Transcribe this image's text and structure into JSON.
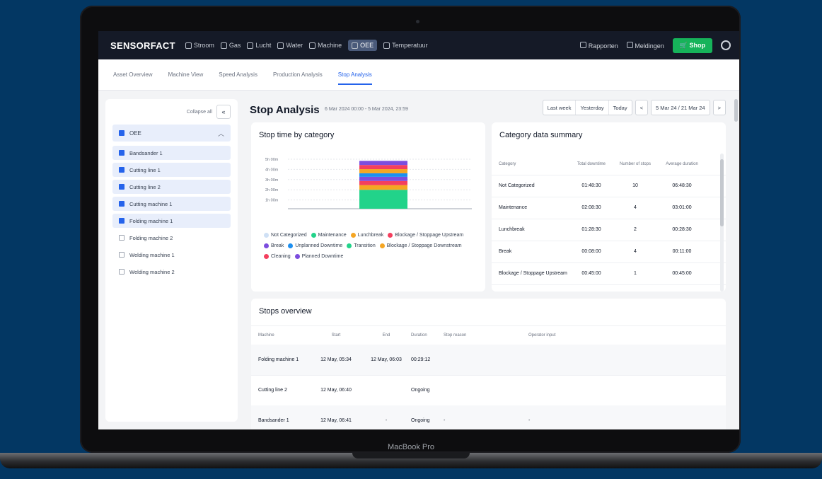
{
  "device": {
    "label": "MacBook Pro"
  },
  "topbar": {
    "brand": "SENSORFACT",
    "nav": [
      "Stroom",
      "Gas",
      "Lucht",
      "Water",
      "Machine",
      "OEE",
      "Temperatuur"
    ],
    "active_nav": "OEE",
    "right": {
      "rapport": "Rapporten",
      "notifications": "Meldingen",
      "shop": "Shop"
    }
  },
  "subtabs": {
    "items": [
      "Asset Overview",
      "Machine View",
      "Speed Analysis",
      "Production Analysis",
      "Stop Analysis"
    ],
    "active": "Stop Analysis"
  },
  "sidebar": {
    "collapse_label": "Collapse all",
    "collapse_icon": "«",
    "group": "OEE",
    "machines": [
      {
        "label": "Bandsander 1",
        "checked": true
      },
      {
        "label": "Cutting line 1",
        "checked": true
      },
      {
        "label": "Cutting line 2",
        "checked": true
      },
      {
        "label": "Cutting machine 1",
        "checked": true
      },
      {
        "label": "Folding machine 1",
        "checked": true
      },
      {
        "label": "Folding machine 2",
        "checked": false
      },
      {
        "label": "Welding machine 1",
        "checked": false
      },
      {
        "label": "Welding machine 2",
        "checked": false
      }
    ]
  },
  "page": {
    "title": "Stop Analysis",
    "date_range": "6 Mar 2024 00:00 - 5 Mar 2024, 23:59",
    "date_buttons": [
      "Last week",
      "Yesterday",
      "Today"
    ],
    "prev_icon": "<",
    "next_icon": ">",
    "range_label": "5 Mar 24 / 21 Mar 24"
  },
  "chart_card": {
    "title": "Stop time by category"
  },
  "chart_data": {
    "type": "bar",
    "stacked": true,
    "categories": [
      ""
    ],
    "ytick_labels": [
      "5h 00m",
      "4h 00m",
      "3h 00m",
      "2h 00m",
      "1h 00m"
    ],
    "series": [
      {
        "name": "Not Categorized",
        "color": "#cfe0f5",
        "values": [
          0
        ]
      },
      {
        "name": "Maintenance",
        "color": "#22d38a",
        "values": [
          1.6
        ]
      },
      {
        "name": "Lunchbreak",
        "color": "#f5a623",
        "values": [
          0.4
        ]
      },
      {
        "name": "Blockage / Stoppage Upstream",
        "color": "#f43f5e",
        "values": [
          0.35
        ]
      },
      {
        "name": "Break",
        "color": "#7c4dde",
        "values": [
          0.35
        ]
      },
      {
        "name": "Unplanned Downtime",
        "color": "#1d8ff0",
        "values": [
          0.3
        ]
      },
      {
        "name": "Transition",
        "color": "#22d38a",
        "values": [
          0
        ]
      },
      {
        "name": "Blockage / Stoppage Downstream",
        "color": "#f5a623",
        "values": [
          0.35
        ]
      },
      {
        "name": "Cleaning",
        "color": "#f43f5e",
        "values": [
          0.35
        ]
      },
      {
        "name": "Planned Downtime",
        "color": "#7c4dde",
        "values": [
          0.35
        ]
      }
    ],
    "ylim": [
      0,
      5
    ]
  },
  "summary": {
    "title": "Category data summary",
    "headers": [
      "Category",
      "Total downtime",
      "Number of stops",
      "Average duration"
    ],
    "rows": [
      [
        "Not Categorized",
        "01:48:30",
        "10",
        "06:48:30"
      ],
      [
        "Maintenance",
        "02:08:30",
        "4",
        "03:01:00"
      ],
      [
        "Lunchbreak",
        "01:28:30",
        "2",
        "00:28:30"
      ],
      [
        "Break",
        "00:08:00",
        "4",
        "00:11:00"
      ],
      [
        "Blockage / Stoppage Upstream",
        "00:45:00",
        "1",
        "00:45:00"
      ]
    ]
  },
  "overview": {
    "title": "Stops overview",
    "headers": [
      "Machine",
      "Start",
      "End",
      "Duration",
      "Stop reason",
      "Operator input"
    ],
    "rows": [
      [
        "Folding machine 1",
        "12 May, 05:34",
        "12 May, 06:03",
        "00:29:12",
        "",
        ""
      ],
      [
        "Cutting line 2",
        "12 May, 06:40",
        "",
        "Ongoing",
        "",
        ""
      ],
      [
        "Bandsander 1",
        "12 May, 06:41",
        "-",
        "Ongoing",
        "-",
        "-"
      ]
    ]
  }
}
